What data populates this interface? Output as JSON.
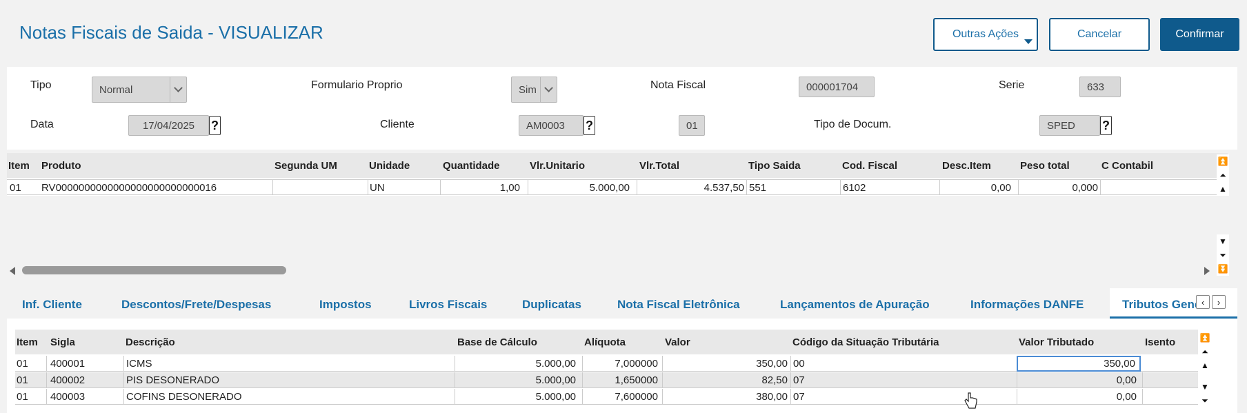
{
  "page": {
    "title": "Notas Fiscais de Saida - VISUALIZAR"
  },
  "actions": {
    "other": "Outras Ações",
    "cancel": "Cancelar",
    "confirm": "Confirmar"
  },
  "header": {
    "tipo_label": "Tipo",
    "tipo_value": "Normal",
    "formulario_label": "Formulario Proprio",
    "formulario_value": "Sim",
    "nota_label": "Nota Fiscal",
    "nota_value": "000001704",
    "serie_label": "Serie",
    "serie_value": "633",
    "data_label": "Data",
    "data_value": "17/04/2025",
    "cliente_label": "Cliente",
    "cliente_value": "AM0003",
    "loja_value": "01",
    "tipodoc_label": "Tipo de Docum.",
    "tipodoc_value": "SPED",
    "help": "?"
  },
  "items_grid": {
    "columns": [
      "Item",
      "Produto",
      "Segunda UM",
      "Unidade",
      "Quantidade",
      "Vlr.Unitario",
      "Vlr.Total",
      "Tipo Saida",
      "Cod. Fiscal",
      "Desc.Item",
      "Peso total",
      "C Contabil"
    ],
    "rows": [
      [
        "01",
        "RV0000000000000000000000000016",
        "",
        "UN",
        "1,00",
        "5.000,00",
        "4.537,50",
        "551",
        "6102",
        "0,00",
        "0,000",
        ""
      ]
    ]
  },
  "tabs": [
    "Inf. Cliente",
    "Descontos/Frete/Despesas",
    "Impostos",
    "Livros Fiscais",
    "Duplicatas",
    "Nota Fiscal Eletrônica",
    "Lançamentos de Apuração",
    "Informações DANFE",
    "Tributos Generi"
  ],
  "tributos_grid": {
    "columns": [
      "Item",
      "Sigla",
      "Descrição",
      "Base de Cálculo",
      "Alíquota",
      "Valor",
      "Código da Situação Tributária",
      "Valor Tributado",
      "Isento"
    ],
    "rows": [
      [
        "01",
        "400001",
        "ICMS",
        "5.000,00",
        "7,000000",
        "350,00",
        "00",
        "350,00",
        ""
      ],
      [
        "01",
        "400002",
        "PIS DESONERADO",
        "5.000,00",
        "1,650000",
        "82,50",
        "07",
        "0,00",
        ""
      ],
      [
        "01",
        "400003",
        "COFINS DESONERADO",
        "5.000,00",
        "7,600000",
        "380,00",
        "07",
        "0,00",
        ""
      ]
    ]
  },
  "colors": {
    "accent": "#1a6fa8",
    "primary_button": "#0f5a8c",
    "field_bg": "#d9d9d9"
  }
}
